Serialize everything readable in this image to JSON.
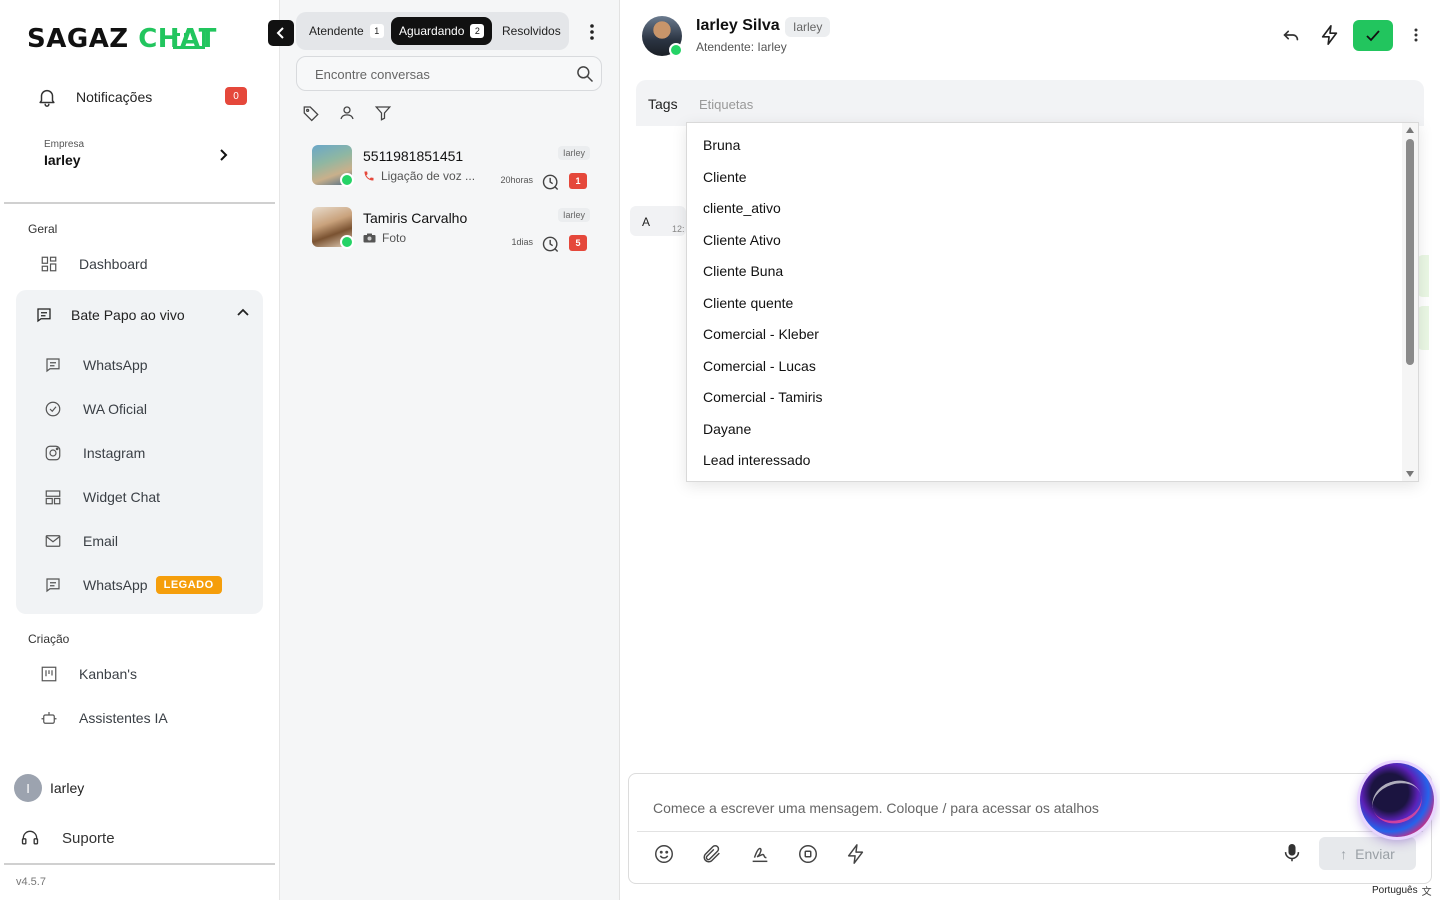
{
  "brand": {
    "part1": "SAGAZ ",
    "part2": "CHAT"
  },
  "sidebar": {
    "notifications_label": "Notificações",
    "notifications_count": "0",
    "company_key": "Empresa",
    "company_value": "Iarley",
    "section_general": "Geral",
    "dashboard": "Dashboard",
    "live_chat": "Bate Papo ao vivo",
    "live_items": [
      {
        "label": "WhatsApp"
      },
      {
        "label": "WA Oficial"
      },
      {
        "label": "Instagram"
      },
      {
        "label": "Widget Chat"
      },
      {
        "label": "Email"
      },
      {
        "label": "WhatsApp",
        "badge": "LEGADO"
      }
    ],
    "section_creation": "Criação",
    "creation_items": [
      {
        "label": "Kanban's"
      },
      {
        "label": "Assistentes IA"
      }
    ],
    "user_initial": "I",
    "user_name": "Iarley",
    "support": "Suporte",
    "version": "v4.5.7"
  },
  "list": {
    "tabs": [
      {
        "label": "Atendente",
        "count": "1"
      },
      {
        "label": "Aguardando",
        "count": "2",
        "active": true
      },
      {
        "label": "Resolvidos"
      }
    ],
    "search_placeholder": "Encontre conversas",
    "conversations": [
      {
        "name": "5511981851451",
        "preview_icon": "phone-icon",
        "preview": "Ligação de voz ...",
        "agent": "Iarley",
        "time": "20horas",
        "unread": "1"
      },
      {
        "name": "Tamiris Carvalho",
        "preview_icon": "camera-icon",
        "preview": "Foto",
        "agent": "Iarley",
        "time": "1dias",
        "unread": "5"
      }
    ]
  },
  "chat": {
    "contact_name": "Iarley Silva",
    "contact_agent_tag": "Iarley",
    "subtitle": "Atendente: Iarley",
    "tags_label": "Tags",
    "tags_placeholder": "Etiquetas",
    "tag_options": [
      "Bruna",
      "Cliente",
      "cliente_ativo",
      "Cliente Ativo",
      "Cliente Buna",
      "Cliente quente",
      "Comercial - Kleber",
      "Comercial - Lucas",
      "Comercial - Tamiris",
      "Dayane",
      "Lead interessado"
    ],
    "message_text": "A",
    "message_time": "12:",
    "composer_placeholder": "Comece a escrever uma mensagem. Coloque / para acessar os atalhos",
    "send_label": "Enviar",
    "language": "Português"
  },
  "colors": {
    "accent_green": "#22c55e",
    "badge_red": "#e5483b",
    "legado_orange": "#f59e0b"
  }
}
